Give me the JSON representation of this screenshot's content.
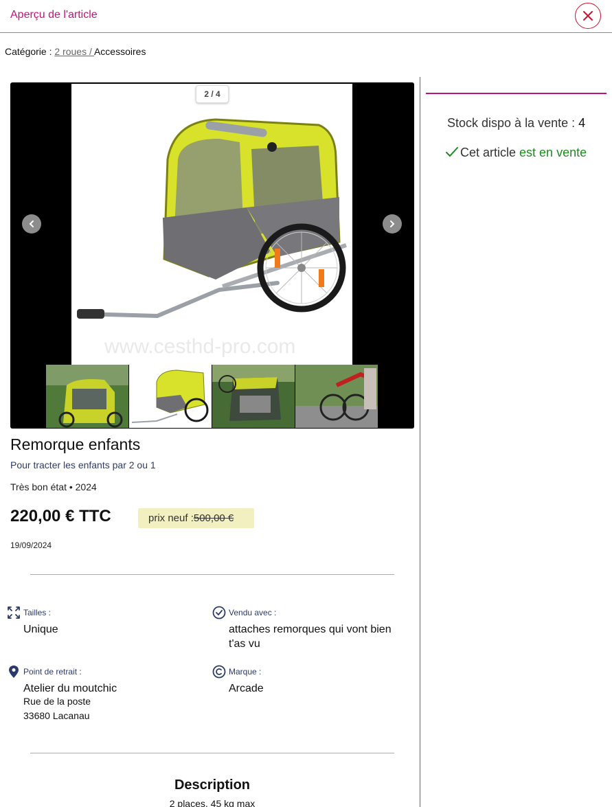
{
  "header": {
    "title": "Aperçu de l'article",
    "close_icon": "close-icon"
  },
  "breadcrumb": {
    "prefix": "Catégorie : ",
    "parent": "2 roues / ",
    "current": "Accessoires"
  },
  "gallery": {
    "counter": "2 / 4",
    "current_index": 2,
    "total": 4,
    "prev_icon": "chevron-left-icon",
    "next_icon": "chevron-right-icon"
  },
  "product": {
    "name": "Remorque enfants",
    "subtitle": "Pour tracter les enfants par 2 ou 1",
    "condition": "Très bon état • 2024",
    "price": "220,00 € TTC",
    "new_price_label": "prix neuf : ",
    "new_price_value": "500,00 €",
    "date": "19/09/2024"
  },
  "attributes": {
    "sizes": {
      "label": "Tailles :",
      "value": "Unique",
      "icon": "expand-icon"
    },
    "sold_with": {
      "label": "Vendu avec :",
      "value": "attaches remorques qui vont bien t'as vu",
      "icon": "check-circle-icon"
    },
    "pickup": {
      "label": "Point de retrait :",
      "value": "Atelier du moutchic",
      "street": "Rue de la poste",
      "city": "33680 Lacanau",
      "icon": "location-pin-icon"
    },
    "brand": {
      "label": "Marque :",
      "value": "Arcade",
      "icon": "copyright-icon"
    }
  },
  "description": {
    "title": "Description",
    "text": "2 places, 45 kg max"
  },
  "sidebar": {
    "stock_label": "Stock dispo à la vente : ",
    "stock_value": "4",
    "sale_prefix": "Cet article",
    "sale_status": "est en vente"
  },
  "colors": {
    "accent": "#c2127a",
    "close": "#d0102c",
    "success": "#1f8a1f",
    "navy": "#2c3a6b",
    "price_badge": "#f2efc0"
  }
}
